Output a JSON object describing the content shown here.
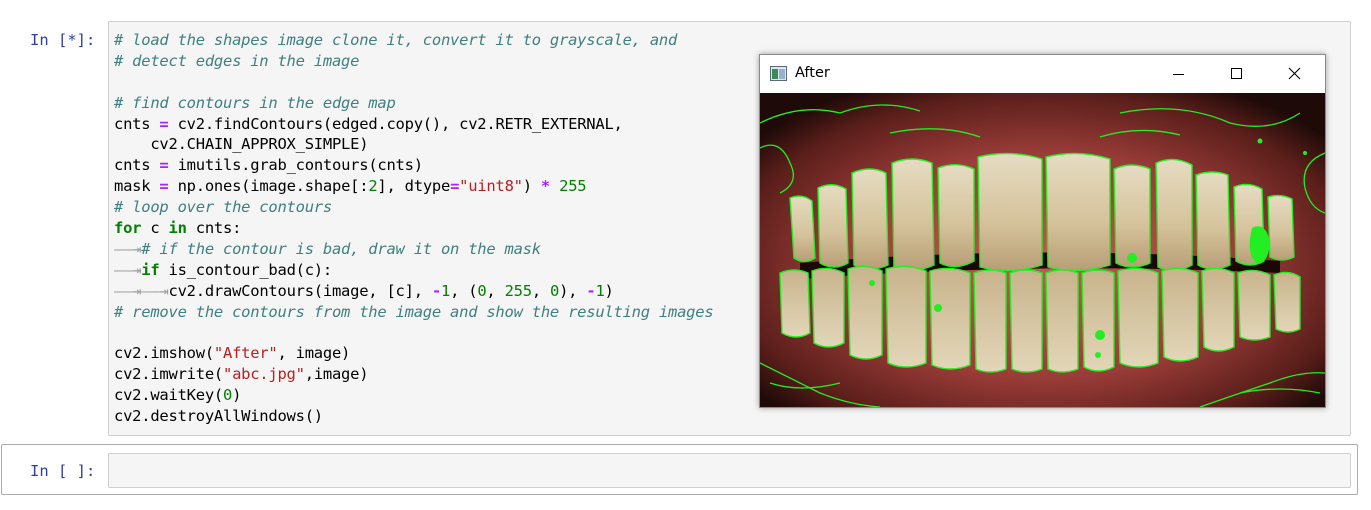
{
  "cells": [
    {
      "prompt": "In [*]:",
      "code_lines": [
        [
          [
            "cm",
            "# load the shapes image clone it, convert it to grayscale, and"
          ]
        ],
        [
          [
            "cm",
            "# detect edges in the image"
          ]
        ],
        [],
        [
          [
            "cm",
            "# find contours in the edge map"
          ]
        ],
        [
          [
            "",
            "cnts "
          ],
          [
            "op",
            "="
          ],
          [
            "",
            " cv2.findContours(edged.copy(), cv2.RETR_EXTERNAL,"
          ]
        ],
        [
          [
            "",
            "    cv2.CHAIN_APPROX_SIMPLE)"
          ]
        ],
        [
          [
            "",
            "cnts "
          ],
          [
            "op",
            "="
          ],
          [
            "",
            " imutils.grab_contours(cnts)"
          ]
        ],
        [
          [
            "",
            "mask "
          ],
          [
            "op",
            "="
          ],
          [
            "",
            " np.ones(image.shape[:"
          ],
          [
            "num",
            "2"
          ],
          [
            "",
            "], dtype"
          ],
          [
            "op",
            "="
          ],
          [
            "str",
            "\"uint8\""
          ],
          [
            "",
            ") "
          ],
          [
            "op",
            "*"
          ],
          [
            "",
            " "
          ],
          [
            "num",
            "255"
          ]
        ],
        [
          [
            "cm",
            "# loop over the contours"
          ]
        ],
        [
          [
            "kw",
            "for"
          ],
          [
            "",
            " c "
          ],
          [
            "kw",
            "in"
          ],
          [
            "",
            " cnts:"
          ]
        ],
        [
          [
            "tab",
            "——⇥"
          ],
          [
            "cm",
            "# if the contour is bad, draw it on the mask"
          ]
        ],
        [
          [
            "tab",
            "——⇥"
          ],
          [
            "kw",
            "if"
          ],
          [
            "",
            " is_contour_bad(c):"
          ]
        ],
        [
          [
            "tab",
            "——⇥——⇥"
          ],
          [
            "",
            "cv2.drawContours(image, [c], "
          ],
          [
            "op",
            "-"
          ],
          [
            "num",
            "1"
          ],
          [
            "",
            ", ("
          ],
          [
            "num",
            "0"
          ],
          [
            "",
            ", "
          ],
          [
            "num",
            "255"
          ],
          [
            "",
            ", "
          ],
          [
            "num",
            "0"
          ],
          [
            "",
            "), "
          ],
          [
            "op",
            "-"
          ],
          [
            "num",
            "1"
          ],
          [
            "",
            ")"
          ]
        ],
        [
          [
            "cm",
            "# remove the contours from the image and show the resulting images"
          ]
        ],
        [],
        [
          [
            "",
            "cv2.imshow("
          ],
          [
            "str",
            "\"After\""
          ],
          [
            "",
            ", image)"
          ]
        ],
        [
          [
            "",
            "cv2.imwrite("
          ],
          [
            "str",
            "\"abc.jpg\""
          ],
          [
            "",
            ",image)"
          ]
        ],
        [
          [
            "",
            "cv2.waitKey("
          ],
          [
            "num",
            "0"
          ],
          [
            "",
            ")"
          ]
        ],
        [
          [
            "",
            "cv2.destroyAllWindows()"
          ]
        ]
      ]
    },
    {
      "prompt": "In [ ]:"
    }
  ],
  "opencv_window": {
    "title": "After",
    "icon": "image-window-icon",
    "buttons": [
      "minimize-icon",
      "maximize-icon",
      "close-icon"
    ],
    "image_description_colors": {
      "contour": "#22ee22",
      "gum": "#a8403e",
      "tooth": "#d8c6a0",
      "background": "#1a0a08"
    }
  }
}
